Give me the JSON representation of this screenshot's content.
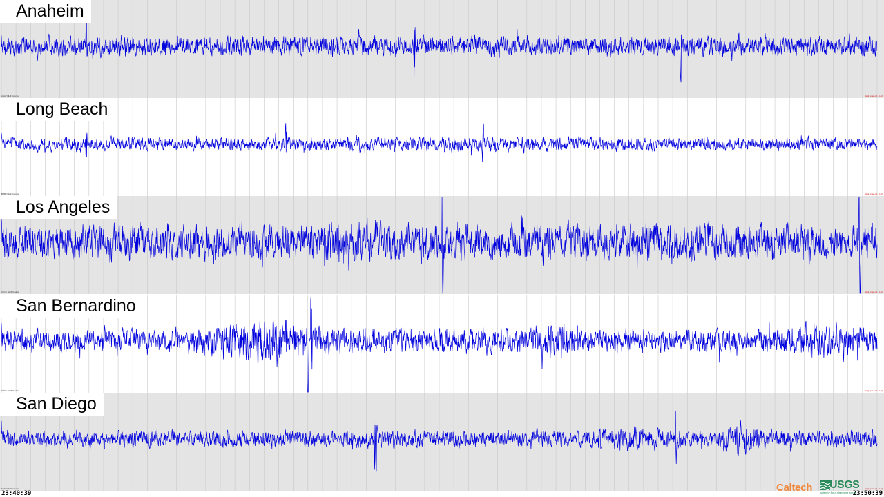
{
  "chart_data": {
    "type": "line",
    "title": "",
    "series": [
      {
        "name": "Anaheim",
        "info_left": "AAA / HHZ  Counts",
        "info_right": "High pass (0.1 Hz)",
        "amplitude": 0.5,
        "spikes": [
          [
            0.472,
            1.2
          ],
          [
            0.776,
            1.0
          ],
          [
            0.097,
            0.6
          ]
        ],
        "bursts": []
      },
      {
        "name": "Long Beach",
        "info_left": "BBB / HHZ  Counts",
        "info_right": "High pass (0.1 Hz)",
        "amplitude": 0.32,
        "spikes": [
          [
            0.097,
            1.1
          ],
          [
            0.325,
            0.9
          ],
          [
            0.55,
            0.5
          ]
        ],
        "bursts": [
          [
            0.5,
            0.12,
            0.15
          ],
          [
            0.62,
            0.1,
            0.1
          ]
        ]
      },
      {
        "name": "Los Angeles",
        "info_left": "CCC / HHZ  Counts",
        "info_right": "High pass (0.1 Hz)",
        "amplitude": 0.85,
        "spikes": [
          [
            0.504,
            1.3
          ],
          [
            0.98,
            1.1
          ]
        ],
        "bursts": [
          [
            0.4,
            0.08,
            0.2
          ],
          [
            0.76,
            0.1,
            0.15
          ]
        ]
      },
      {
        "name": "San Bernardino",
        "info_left": "DDD / HHZ  Counts",
        "info_right": "High pass (0.1 Hz)",
        "amplitude": 0.6,
        "spikes": [
          [
            0.35,
            1.3
          ],
          [
            0.354,
            1.1
          ]
        ],
        "bursts": [
          [
            0.3,
            0.05,
            1.0
          ],
          [
            0.64,
            0.025,
            0.7
          ],
          [
            0.93,
            0.04,
            0.45
          ]
        ]
      },
      {
        "name": "San Diego",
        "info_left": "EEE / HHZ  Counts",
        "info_right": "High pass (0.1 Hz)",
        "amplitude": 0.42,
        "spikes": [
          [
            0.426,
            1.5
          ],
          [
            0.428,
            1.2
          ],
          [
            0.77,
            0.9
          ]
        ],
        "bursts": [
          [
            0.848,
            0.02,
            0.9
          ],
          [
            0.72,
            0.035,
            0.5
          ]
        ]
      }
    ],
    "x_start": "23:40:39",
    "x_end": "23:50:39",
    "grid": true,
    "line_color": "#0000dd",
    "band_colors": [
      "#e4e4e4",
      "#ffffff"
    ],
    "grid_color": "#c8c8c8"
  },
  "logos": {
    "caltech": "Caltech",
    "usgs": "USGS",
    "usgs_tagline": "science for a changing world",
    "caltech_color": "#f0883c",
    "usgs_color": "#2a8a5a"
  }
}
